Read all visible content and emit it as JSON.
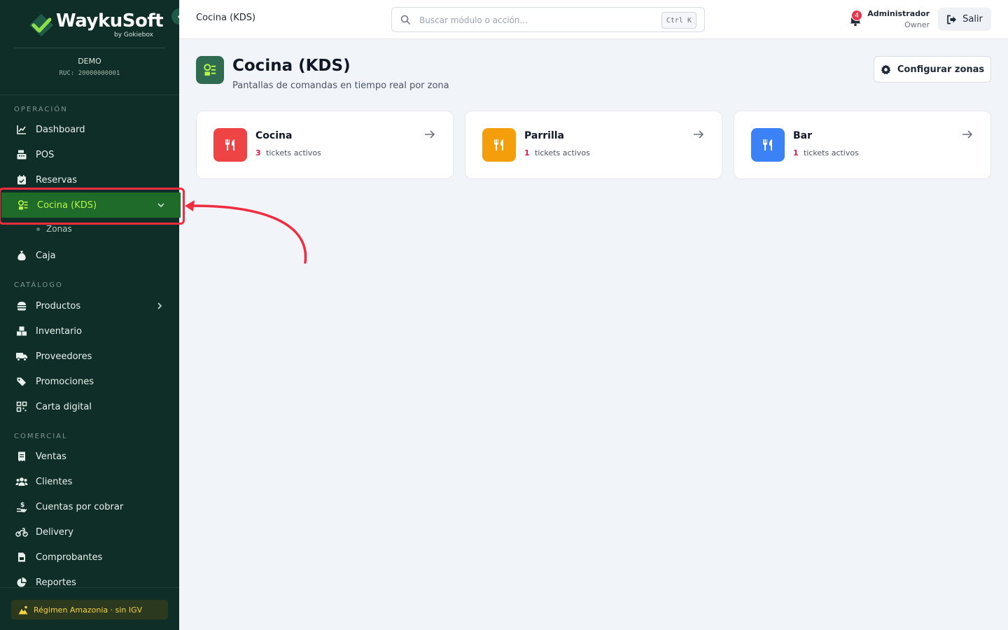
{
  "sidebar": {
    "brand": {
      "name": "WaykuSoft",
      "by": "by Gokiebox"
    },
    "company": "DEMO",
    "ruc": "RUC: 20000000001",
    "sections": {
      "operacion": "OPERACIÓN",
      "catalogo": "CATÁLOGO",
      "comercial": "COMERCIAL"
    },
    "items": {
      "dashboard": "Dashboard",
      "pos": "POS",
      "reservas": "Reservas",
      "cocina": "Cocina (KDS)",
      "zonas": "Zonas",
      "caja": "Caja",
      "productos": "Productos",
      "inventario": "Inventario",
      "proveedores": "Proveedores",
      "promociones": "Promociones",
      "carta": "Carta digital",
      "ventas": "Ventas",
      "clientes": "Clientes",
      "cuentas": "Cuentas por cobrar",
      "delivery": "Delivery",
      "comprobantes": "Comprobantes",
      "reportes": "Reportes"
    },
    "footer": "Régimen Amazonia · sin IGV"
  },
  "topbar": {
    "breadcrumb": "Cocina (KDS)",
    "search_placeholder": "Buscar módulo o acción...",
    "shortcut": "Ctrl K",
    "notifications": "4",
    "user_name": "Administrador",
    "user_role": "Owner",
    "logout": "Salir"
  },
  "page": {
    "title": "Cocina (KDS)",
    "subtitle": "Pantallas de comandas en tiempo real por zona",
    "config_button": "Configurar zonas"
  },
  "zones": [
    {
      "name": "Cocina",
      "count": "3",
      "label": "tickets activos",
      "color": "#ef4444"
    },
    {
      "name": "Parrilla",
      "count": "1",
      "label": "tickets activos",
      "color": "#f59e0b"
    },
    {
      "name": "Bar",
      "count": "1",
      "label": "tickets activos",
      "color": "#3b82f6"
    }
  ],
  "colors": {
    "sidebar_bg": "#0f2e27",
    "active_bg": "#1f6b2a",
    "active_text": "#b7f34a",
    "annotation": "#ef2d3f"
  }
}
